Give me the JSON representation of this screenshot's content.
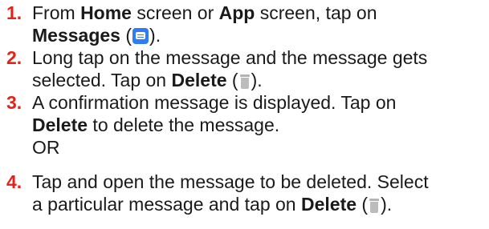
{
  "steps": [
    {
      "number": "1.",
      "parts": {
        "t1": "From ",
        "b1": "Home",
        "t2": " screen or ",
        "b2": "App",
        "t3": " screen, tap on",
        "b3": "Messages",
        "t4": " (",
        "t5": ")."
      }
    },
    {
      "number": "2.",
      "parts": {
        "t1": "Long tap on the message and the message gets",
        "t2": "selected. Tap on ",
        "b1": "Delete",
        "t3": " (",
        "t4": ")."
      }
    },
    {
      "number": "3.",
      "parts": {
        "t1": "A confirmation message is displayed. Tap on",
        "b1": "Delete",
        "t2": " to delete the message.",
        "or": "OR"
      }
    },
    {
      "number": "4.",
      "parts": {
        "t1": "Tap and open the message to be deleted. Select",
        "t2": "a particular message and tap on ",
        "b1": "Delete",
        "t3": " (",
        "t4": ")."
      }
    }
  ],
  "icons": {
    "messages": "messages-app-icon",
    "delete": "trash-icon"
  },
  "colors": {
    "step_number": "#e2231a",
    "text": "#1a1a1a",
    "messages_icon": "#2f7df6",
    "trash_icon": "#bcbcbc"
  }
}
